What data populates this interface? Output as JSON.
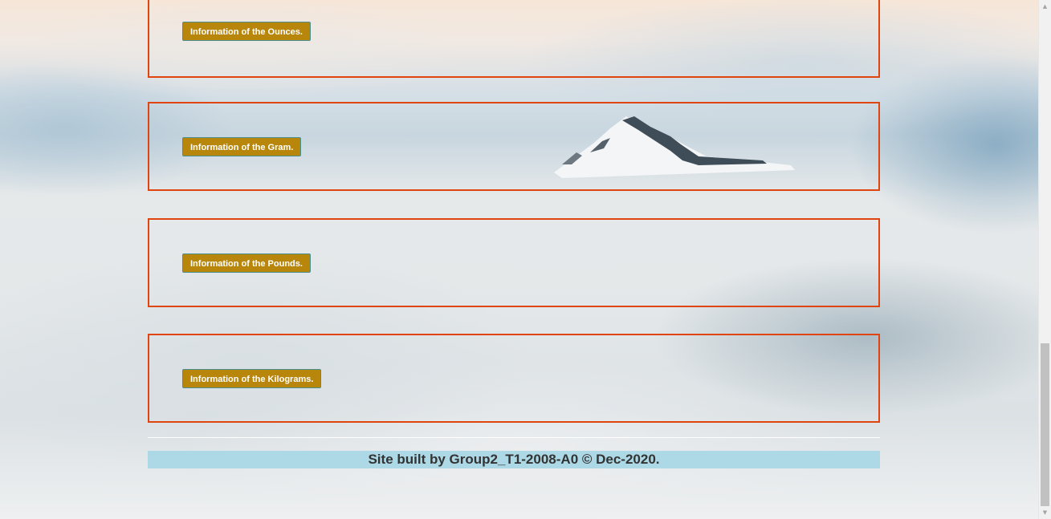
{
  "panels": [
    {
      "button_label": "Information of the Ounces."
    },
    {
      "button_label": "Information of the Gram."
    },
    {
      "button_label": "Information of the Pounds."
    },
    {
      "button_label": "Information of the Kilograms."
    }
  ],
  "footer": {
    "text": "Site built by Group2_T1-2008-A0 © Dec-2020."
  },
  "colors": {
    "panel_border": "#e0450f",
    "button_bg": "#b8860b",
    "footer_bg": "#add8e6"
  },
  "icons": {
    "scroll_up": "triangle-up-icon",
    "scroll_down": "triangle-down-icon"
  }
}
